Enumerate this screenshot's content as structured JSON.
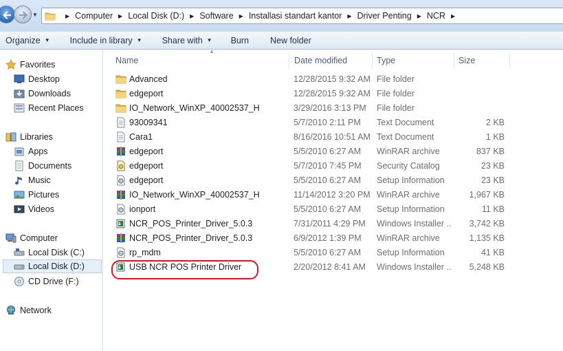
{
  "breadcrumb": [
    "Computer",
    "Local Disk (D:)",
    "Software",
    "Installasi standart kantor",
    "Driver Penting",
    "NCR"
  ],
  "toolbar": {
    "organize": "Organize",
    "include": "Include in library",
    "share": "Share with",
    "burn": "Burn",
    "new_folder": "New folder"
  },
  "nav": {
    "favorites": "Favorites",
    "desktop": "Desktop",
    "downloads": "Downloads",
    "recent": "Recent Places",
    "libraries": "Libraries",
    "apps": "Apps",
    "documents": "Documents",
    "music": "Music",
    "pictures": "Pictures",
    "videos": "Videos",
    "computer": "Computer",
    "local_c": "Local Disk (C:)",
    "local_d": "Local Disk (D:)",
    "cd_drive": "CD Drive (F:)",
    "network": "Network"
  },
  "columns": {
    "name": "Name",
    "date": "Date modified",
    "type": "Type",
    "size": "Size"
  },
  "files": [
    {
      "name": "Advanced",
      "date": "12/28/2015 9:32 AM",
      "type": "File folder",
      "size": "",
      "icon": "folder-icon"
    },
    {
      "name": "edgeport",
      "date": "12/28/2015 9:32 AM",
      "type": "File folder",
      "size": "",
      "icon": "folder-icon"
    },
    {
      "name": "IO_Network_WinXP_40002537_H",
      "date": "3/29/2016 3:13 PM",
      "type": "File folder",
      "size": "",
      "icon": "folder-icon"
    },
    {
      "name": "93009341",
      "date": "5/7/2010 2:11 PM",
      "type": "Text Document",
      "size": "2 KB",
      "icon": "text-document-icon"
    },
    {
      "name": "Cara1",
      "date": "8/16/2016 10:51 AM",
      "type": "Text Document",
      "size": "1 KB",
      "icon": "text-document-icon"
    },
    {
      "name": "edgeport",
      "date": "5/5/2010 6:27 AM",
      "type": "WinRAR archive",
      "size": "837 KB",
      "icon": "winrar-icon"
    },
    {
      "name": "edgeport",
      "date": "5/7/2010 7:45 PM",
      "type": "Security Catalog",
      "size": "23 KB",
      "icon": "security-catalog-icon"
    },
    {
      "name": "edgeport",
      "date": "5/5/2010 6:27 AM",
      "type": "Setup Information",
      "size": "23 KB",
      "icon": "setup-info-icon"
    },
    {
      "name": "IO_Network_WinXP_40002537_H",
      "date": "11/14/2012 3:20 PM",
      "type": "WinRAR archive",
      "size": "1,967 KB",
      "icon": "winrar-icon"
    },
    {
      "name": "ionport",
      "date": "5/5/2010 6:27 AM",
      "type": "Setup Information",
      "size": "11 KB",
      "icon": "setup-info-icon"
    },
    {
      "name": "NCR_POS_Printer_Driver_5.0.3",
      "date": "7/31/2011 4:29 PM",
      "type": "Windows Installer ...",
      "size": "3,742 KB",
      "icon": "installer-icon"
    },
    {
      "name": "NCR_POS_Printer_Driver_5.0.3",
      "date": "6/9/2012 1:39 PM",
      "type": "WinRAR archive",
      "size": "1,135 KB",
      "icon": "winrar-icon"
    },
    {
      "name": "rp_mdm",
      "date": "5/5/2010 6:27 AM",
      "type": "Setup Information",
      "size": "41 KB",
      "icon": "setup-info-icon"
    },
    {
      "name": "USB NCR POS Printer Driver",
      "date": "2/20/2012 8:41 AM",
      "type": "Windows Installer ...",
      "size": "5,248 KB",
      "icon": "installer-icon"
    }
  ],
  "colors": {
    "highlight_ring": "#e0141b",
    "selected_nav": "#e5eff9"
  }
}
